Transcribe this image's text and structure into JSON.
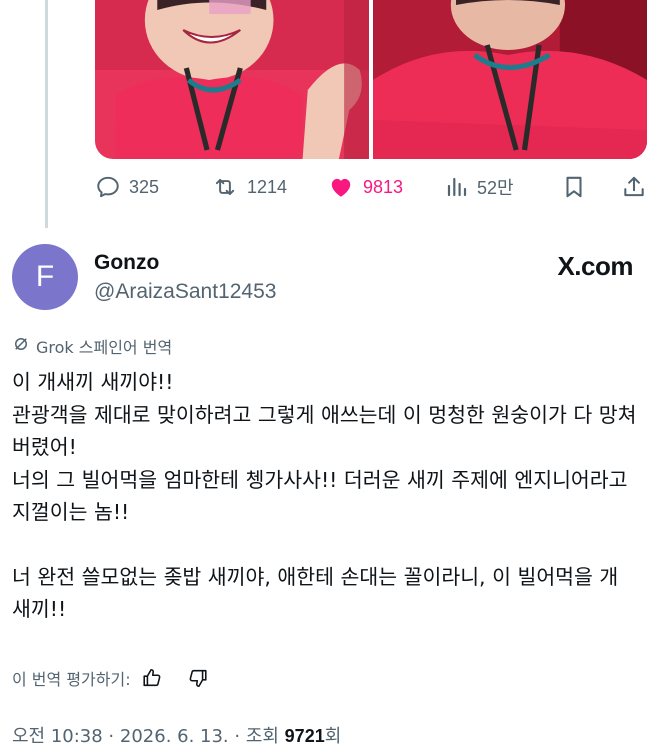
{
  "tweet_actions": {
    "replies": "325",
    "retweets": "1214",
    "likes": "9813",
    "views": "52만",
    "like_color": "#f91880",
    "icons": [
      "reply-icon",
      "retweet-icon",
      "heart-icon",
      "analytics-icon",
      "bookmark-icon",
      "share-icon"
    ]
  },
  "author": {
    "avatar_letter": "F",
    "avatar_color": "#7b76cc",
    "display_name": "Gonzo",
    "handle": "@AraizaSant12453"
  },
  "watermark": "X.com",
  "translation": {
    "label": "Grok 스페인어 번역",
    "rate_label": "이 번역 평가하기:"
  },
  "post": {
    "lines": [
      "이 개새끼 새끼야!!",
      "관광객을 제대로 맞이하려고 그렇게 애쓰는데 이 멍청한 원숭이가 다 망쳐버렸어!",
      "너의 그 빌어먹을 엄마한테 쳉가사사!! 더러운 새끼 주제에 엔지니어라고 지껄이는 놈!!",
      "너 완전 쓸모없는 좆밥 새끼야, 애한테 손대는 꼴이라니, 이 빌어먹을 개새끼!!"
    ]
  },
  "meta": {
    "timestamp": "오전 10:38 · 2026. 6. 13. · 조회 ",
    "views": "9721",
    "views_suffix": "회"
  }
}
